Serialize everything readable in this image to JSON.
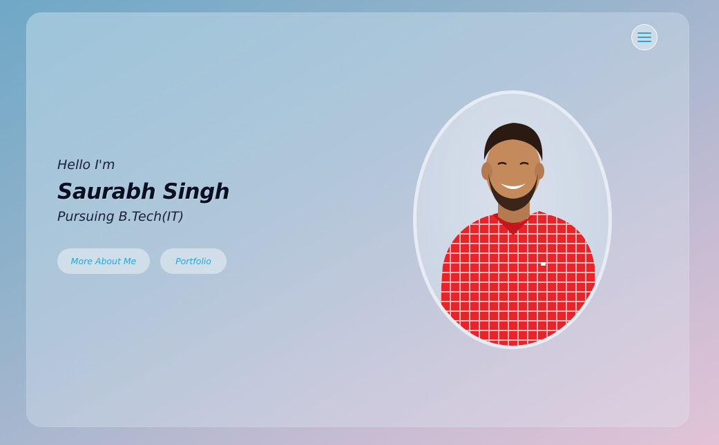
{
  "hero": {
    "greeting": "Hello I'm",
    "name": "Saurabh Singh",
    "tagline": "Pursuing B.Tech(IT)"
  },
  "buttons": {
    "about_label": "More About Me",
    "portfolio_label": "Portfolio"
  },
  "nav": {
    "menu_icon": "hamburger-menu-icon"
  },
  "profile": {
    "photo_subject": "profile-photo"
  },
  "colors": {
    "accent": "#27a5dc",
    "name_text": "#0b0f24",
    "shirt": "#e8232a"
  }
}
